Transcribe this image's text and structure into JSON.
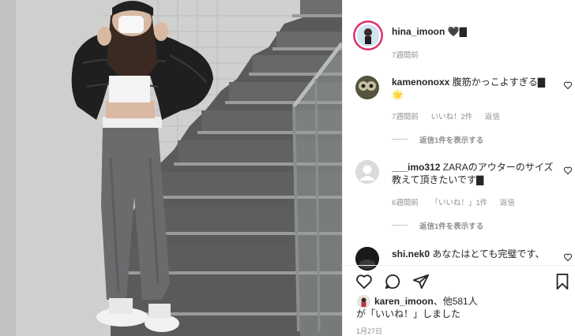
{
  "post": {
    "author": "hina_imoon",
    "caption_emoji": "🖤▇",
    "time": "7週間前"
  },
  "comments": [
    {
      "username": "kamenonoxx",
      "text_line1": "腹筋かっこよすぎる▇",
      "text_line2": "🌟",
      "time": "7週間前",
      "likes": "いいね！2件",
      "reply_label": "返信",
      "view_replies": "返信1件を表示する"
    },
    {
      "username": "___imo312",
      "text_line1": "ZARAのアウターのサイズ",
      "text_line2": "教えて頂きたいです▇",
      "time": "6週間前",
      "likes": "「いいね！」1件",
      "reply_label": "返信",
      "view_replies": "返信1件を表示する"
    },
    {
      "username": "shi.nek0",
      "text_line1": "あなたはとても完璧です、",
      "text_line2": ""
    }
  ],
  "likes_section": {
    "liker": "karen_imoon",
    "others": "、他581人",
    "line2": "が「いいね！」しました"
  },
  "post_date": "1月27日",
  "icons": [
    "heart-icon",
    "comment-icon",
    "share-icon",
    "bookmark-icon"
  ]
}
